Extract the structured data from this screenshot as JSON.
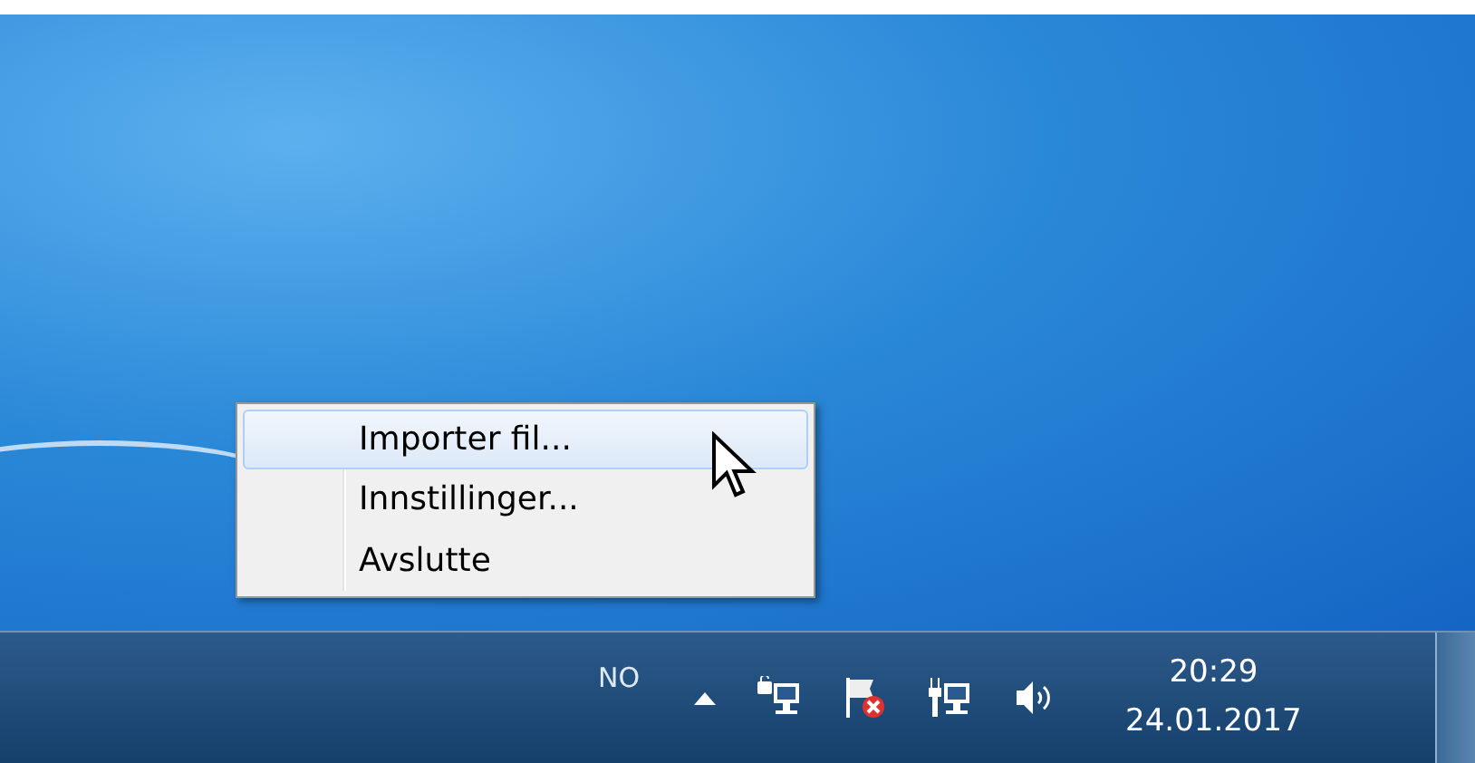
{
  "context_menu": {
    "items": [
      {
        "label": "Importer fil...",
        "selected": true
      },
      {
        "label": "Innstillinger...",
        "selected": false
      },
      {
        "label": "Avslutte",
        "selected": false
      }
    ]
  },
  "taskbar": {
    "language": "NO",
    "tray_icons": [
      {
        "kind": "expand"
      },
      {
        "kind": "network-lock"
      },
      {
        "kind": "flag-error"
      },
      {
        "kind": "network"
      },
      {
        "kind": "volume"
      }
    ],
    "clock": {
      "time": "20:29",
      "date": "24.01.2017"
    }
  }
}
